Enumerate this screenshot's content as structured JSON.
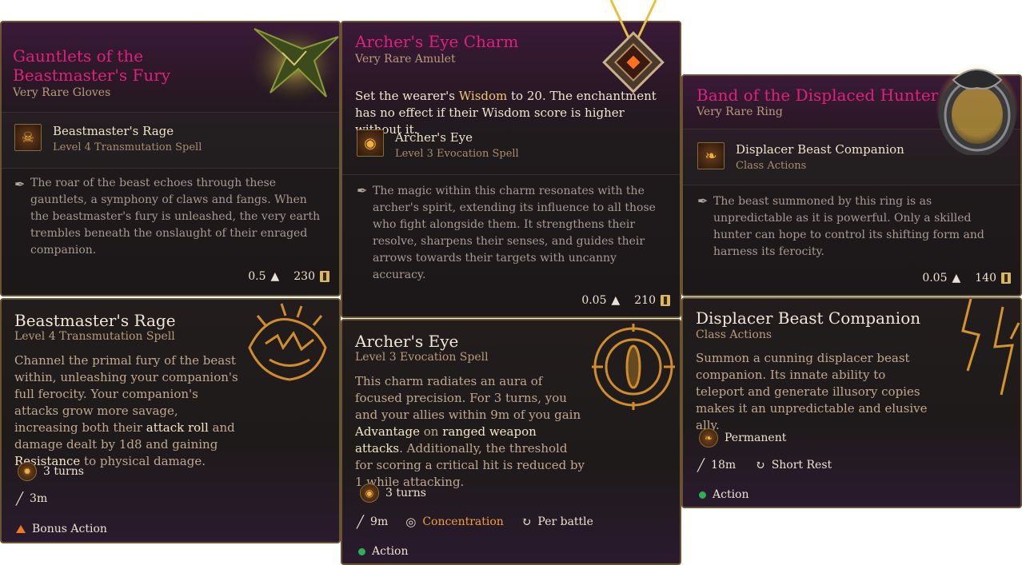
{
  "cards": [
    {
      "item": {
        "name": "Gauntlets of the Beastmaster's Fury",
        "rarity": "Very Rare Gloves",
        "ability_name": "Beastmaster's Rage",
        "ability_sub": "Level 4 Transmutation Spell",
        "flavor": "The roar of the beast echoes through these gauntlets, a symphony of claws and fangs. When the beastmaster's fury is unleashed, the very earth trembles beneath the onslaught of their enraged companion.",
        "weight": "0.5",
        "value": "230"
      },
      "spell": {
        "name": "Beastmaster's Rage",
        "sub": "Level 4 Transmutation Spell",
        "desc_parts": [
          "Channel the primal fury of the beast within, unleashing your companion's full ferocity. Your companion's attacks grow more savage, increasing both their ",
          "attack roll",
          " and damage dealt by 1d8 and gaining ",
          "Resistance",
          " to physical damage."
        ],
        "duration": "3 turns",
        "range": "3m",
        "action": "Bonus Action"
      }
    },
    {
      "item": {
        "name": "Archer's Eye Charm",
        "rarity": "Very Rare Amulet",
        "effect_parts": [
          "Set the wearer's ",
          "Wisdom",
          " to 20. The enchantment has no effect if their Wisdom score is higher without it."
        ],
        "ability_name": "Archer's Eye",
        "ability_sub": "Level 3 Evocation Spell",
        "flavor": "The magic within this charm resonates with the archer's spirit, extending its influence to all those who fight alongside them. It strengthens their resolve, sharpens their senses, and guides their arrows towards their targets with uncanny accuracy.",
        "weight": "0.05",
        "value": "210"
      },
      "spell": {
        "name": "Archer's Eye",
        "sub": "Level 3 Evocation Spell",
        "desc_parts": [
          "This charm radiates an aura of focused precision. For 3 turns, you and your allies within 9m of you gain ",
          "Advantage",
          " on ",
          "ranged weapon attacks",
          ". Additionally, the threshold for scoring a critical hit is reduced by 1 while attacking."
        ],
        "duration": "3 turns",
        "range": "9m",
        "concentration": "Concentration",
        "recharge": "Per battle",
        "action": "Action"
      }
    },
    {
      "item": {
        "name": "Band of the Displaced Hunter",
        "rarity": "Very Rare Ring",
        "ability_name": "Displacer Beast Companion",
        "ability_sub": "Class Actions",
        "flavor": "The beast summoned by this ring is as unpredictable as it is powerful.  Only a skilled hunter can hope to control its shifting form and harness its ferocity.",
        "weight": "0.05",
        "value": "140"
      },
      "spell": {
        "name": "Displacer Beast Companion",
        "sub": "Class Actions",
        "desc": "Summon a cunning displacer beast companion. Its innate ability to teleport and generate illusory copies makes it an unpredictable and elusive ally.",
        "duration": "Permanent",
        "range": "18m",
        "recharge": "Short Rest",
        "action": "Action"
      }
    }
  ],
  "colors": {
    "item_title": "#e0207e",
    "accent_gold": "#f0a040",
    "action_green": "#2fae5a",
    "bonus_orange": "#f07a20"
  },
  "icons": [
    "feather-quill-icon",
    "weight-icon",
    "gold-coin-icon",
    "beast-head-icon",
    "eye-rune-icon",
    "displacer-beast-icon",
    "range-icon",
    "recharge-icon",
    "concentration-icon",
    "turns-icon"
  ]
}
